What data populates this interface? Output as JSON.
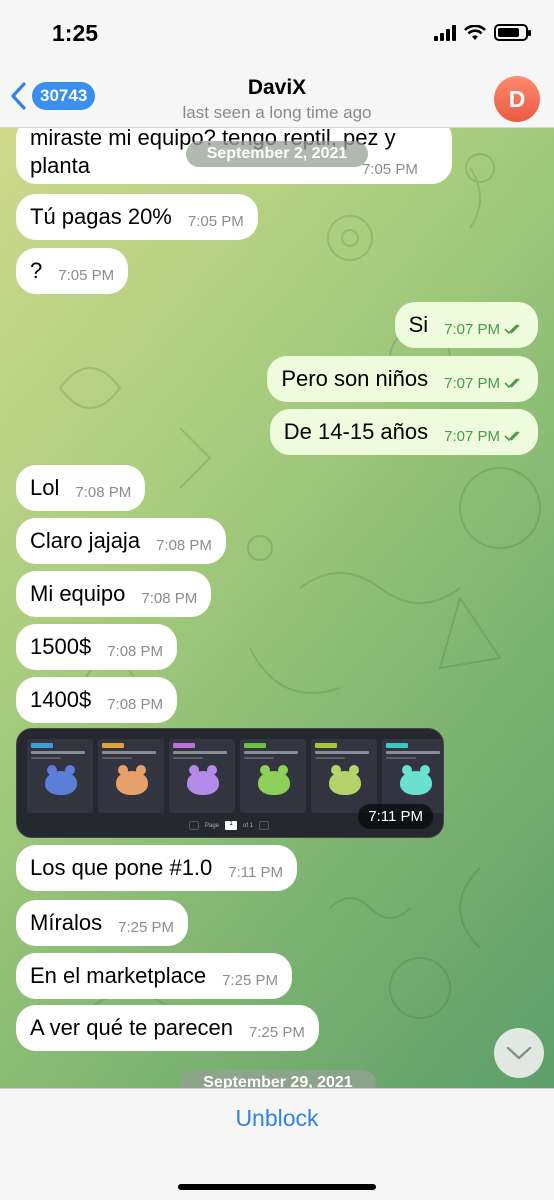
{
  "status": {
    "time": "1:25"
  },
  "header": {
    "back_count": "30743",
    "title": "DaviX",
    "subtitle": "last seen a long time ago",
    "avatar_letter": "D"
  },
  "dates": {
    "first": "September 2, 2021",
    "second": "September 29, 2021"
  },
  "messages": [
    {
      "dir": "in",
      "text": "miraste mi equipo? tengo reptil, pez y",
      "text2": "planta",
      "time": "7:05 PM"
    },
    {
      "dir": "in",
      "text": "Tú pagas 20%",
      "time": "7:05 PM"
    },
    {
      "dir": "in",
      "text": "?",
      "time": "7:05 PM"
    },
    {
      "dir": "out",
      "text": "Si",
      "time": "7:07 PM"
    },
    {
      "dir": "out",
      "text": "Pero son niños",
      "time": "7:07 PM"
    },
    {
      "dir": "out",
      "text": "De 14-15 años",
      "time": "7:07 PM"
    },
    {
      "dir": "in",
      "text": "Lol",
      "time": "7:08 PM"
    },
    {
      "dir": "in",
      "text": "Claro jajaja",
      "time": "7:08 PM"
    },
    {
      "dir": "in",
      "text": "Mi equipo",
      "time": "7:08 PM"
    },
    {
      "dir": "in",
      "text": "1500$",
      "time": "7:08 PM"
    },
    {
      "dir": "in",
      "text": "1400$",
      "time": "7:08 PM"
    },
    {
      "dir": "in",
      "text": "Los que pone #1.0",
      "time": "7:11 PM"
    },
    {
      "dir": "in",
      "text": "Míralos",
      "time": "7:25 PM"
    },
    {
      "dir": "in",
      "text": "En el marketplace",
      "time": "7:25 PM"
    },
    {
      "dir": "in",
      "text": "A ver qué te parecen",
      "time": "7:25 PM"
    }
  ],
  "photo": {
    "time": "7:11 PM",
    "pager_label": "Page",
    "pager_page": "1",
    "pager_of": "of 1",
    "cards": [
      {
        "tag_color": "#3ca0d8",
        "body_color": "#5b7ed8"
      },
      {
        "tag_color": "#e0a03a",
        "body_color": "#e8a06a"
      },
      {
        "tag_color": "#c070d8",
        "body_color": "#b48ae8"
      },
      {
        "tag_color": "#6cc04a",
        "body_color": "#8cd05a"
      },
      {
        "tag_color": "#a8c83a",
        "body_color": "#b4d46a"
      },
      {
        "tag_color": "#3cc8c0",
        "body_color": "#6ae0d0"
      }
    ]
  },
  "footer": {
    "unblock_label": "Unblock"
  },
  "colors": {
    "accent": "#2f83e4",
    "outgoing_bubble": "#eefbdc",
    "incoming_bubble": "#ffffff"
  }
}
